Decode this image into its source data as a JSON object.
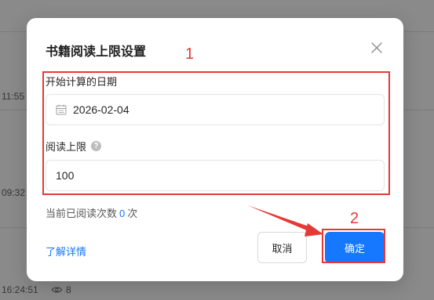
{
  "background": {
    "times": [
      "11:55",
      "09:32",
      "16:24:51"
    ],
    "views": "8"
  },
  "modal": {
    "title": "书籍阅读上限设置",
    "start_date_label": "开始计算的日期",
    "start_date_value": "2026-02-04",
    "limit_label": "阅读上限",
    "limit_value": "100",
    "count_prefix": "当前已阅读次数",
    "count_value": "0",
    "count_suffix": "次",
    "learn_more": "了解详情",
    "cancel_label": "取消",
    "ok_label": "确定"
  },
  "annotations": {
    "label_1": "1",
    "label_2": "2",
    "color": "#e53935"
  },
  "colors": {
    "primary": "#1677ff",
    "overlay": "rgba(0,0,0,0.46)"
  }
}
